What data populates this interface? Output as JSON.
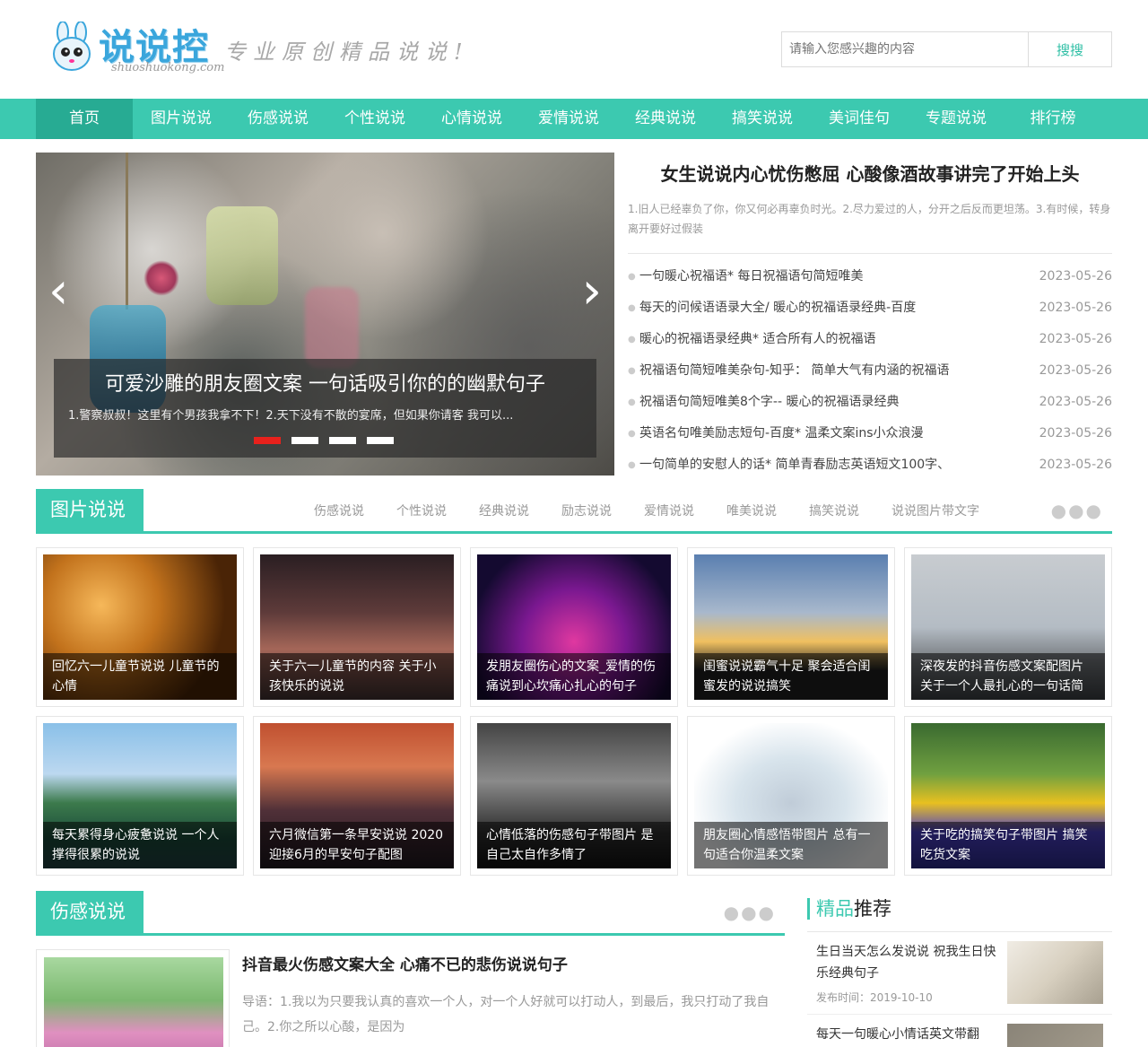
{
  "header": {
    "logo_text": "说说控",
    "logo_domain": "shuoshuokong.com",
    "slogan": "专业原创精品说说!",
    "search_placeholder": "请输入您感兴趣的内容",
    "search_button": "搜搜"
  },
  "nav": [
    "首页",
    "图片说说",
    "伤感说说",
    "个性说说",
    "心情说说",
    "爱情说说",
    "经典说说",
    "搞笑说说",
    "美词佳句",
    "专题说说",
    "排行榜"
  ],
  "slider": {
    "title": "可爱沙雕的朋友圈文案 一句话吸引你的的幽默句子",
    "desc": "1.警察叔叔！这里有个男孩我拿不下！2.天下没有不散的宴席，但如果你请客 我可以...",
    "active_dot": 1,
    "dot_count": 4
  },
  "headline": {
    "title": "女生说说内心忧伤憋屈 心酸像酒故事讲完了开始上头",
    "desc": "1.旧人已经辜负了你，你又何必再辜负时光。2.尽力爱过的人，分开之后反而更坦荡。3.有时候，转身离开要好过假装"
  },
  "news": [
    {
      "title": "一句暖心祝福语* 每日祝福语句简短唯美",
      "date": "2023-05-26"
    },
    {
      "title": "每天的问候语语录大全/ 暖心的祝福语录经典-百度",
      "date": "2023-05-26"
    },
    {
      "title": "暖心的祝福语录经典* 适合所有人的祝福语",
      "date": "2023-05-26"
    },
    {
      "title": "祝福语句简短唯美杂句-知乎： 简单大气有内涵的祝福语",
      "date": "2023-05-26"
    },
    {
      "title": "祝福语句简短唯美8个字-- 暖心的祝福语录经典",
      "date": "2023-05-26"
    },
    {
      "title": "英语名句唯美励志短句-百度* 温柔文案ins小众浪漫",
      "date": "2023-05-26"
    },
    {
      "title": "一句简单的安慰人的话* 简单青春励志英语短文100字、",
      "date": "2023-05-26"
    }
  ],
  "pic_section": {
    "label": "图片说说",
    "tabs": [
      "伤感说说",
      "个性说说",
      "经典说说",
      "励志说说",
      "爱情说说",
      "唯美说说",
      "搞笑说说",
      "说说图片带文字"
    ],
    "more": "●●●",
    "cards": [
      {
        "caption": "回忆六一儿童节说说 儿童节的心情"
      },
      {
        "caption": "关于六一儿童节的内容 关于小孩快乐的说说"
      },
      {
        "caption": "发朋友圈伤心的文案_爱情的伤痛说到心坎痛心扎心的句子"
      },
      {
        "caption": "闺蜜说说霸气十足 聚会适合闺蜜发的说说搞笑"
      },
      {
        "caption": "深夜发的抖音伤感文案配图片 关于一个人最扎心的一句话简"
      },
      {
        "caption": "每天累得身心疲惫说说 一个人撑得很累的说说"
      },
      {
        "caption": "六月微信第一条早安说说 2020迎接6月的早安句子配图"
      },
      {
        "caption": "心情低落的伤感句子带图片 是自己太自作多情了"
      },
      {
        "caption": "朋友圈心情感悟带图片 总有一句适合你温柔文案"
      },
      {
        "caption": "关于吃的搞笑句子带图片 搞笑吃货文案"
      }
    ]
  },
  "sad_section": {
    "label": "伤感说说",
    "more": "●●●",
    "article": {
      "title": "抖音最火伤感文案大全 心痛不已的悲伤说说句子",
      "desc": "导语：1.我以为只要我认真的喜欢一个人，对一个人好就可以打动人，到最后，我只打动了我自己。2.你之所以心酸，是因为"
    }
  },
  "recommend": {
    "label_a": "精品",
    "label_b": "推荐",
    "items": [
      {
        "title": "生日当天怎么发说说 祝我生日快乐经典句子",
        "date": "发布时间：2019-10-10"
      },
      {
        "title": "每天一句暖心小情话英文带翻",
        "date": ""
      }
    ]
  },
  "colors": {
    "accent": "#3cc9b0",
    "accent_dark": "#27ab93",
    "dot_active": "#e8211c"
  }
}
